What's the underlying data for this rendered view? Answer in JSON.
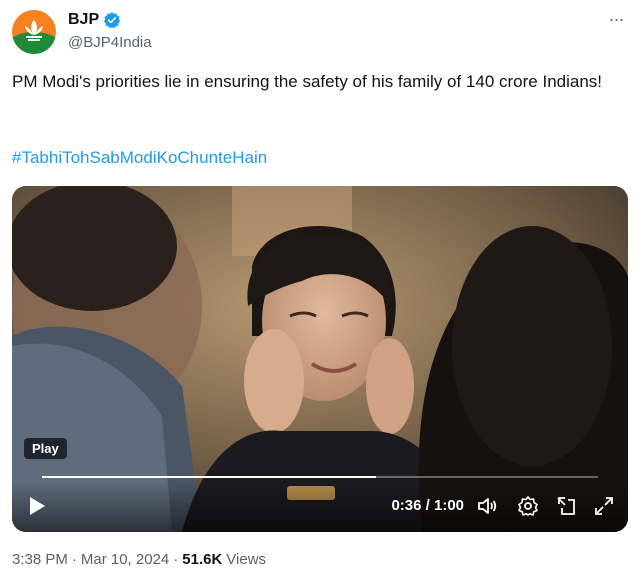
{
  "author": {
    "name": "BJP",
    "handle": "@BJP4India",
    "verified": true,
    "avatar_icon": "bjp-lotus-logo"
  },
  "more_icon": "ellipsis-icon",
  "tweet": {
    "text": "PM Modi's priorities lie in ensuring the safety of his family of 140 crore Indians!",
    "hashtag": "#TabhiTohSabModiKoChunteHain"
  },
  "video": {
    "badge": "Play",
    "time": "0:36 / 1:00",
    "progress": 0.6,
    "icons": [
      "play-icon",
      "volume-icon",
      "settings-icon",
      "pip-icon",
      "fullscreen-icon"
    ]
  },
  "footer": {
    "time": "3:38 PM",
    "separator": "·",
    "date": "Mar 10, 2024",
    "separator2": "·",
    "views_count": "51.6K",
    "views_label": "Views"
  },
  "colors": {
    "link": "#1d9bf0",
    "verified": "#1d9bf0",
    "secondary_text": "#536471",
    "avatar_orange": "#f58220",
    "avatar_green": "#1e8a3a"
  }
}
